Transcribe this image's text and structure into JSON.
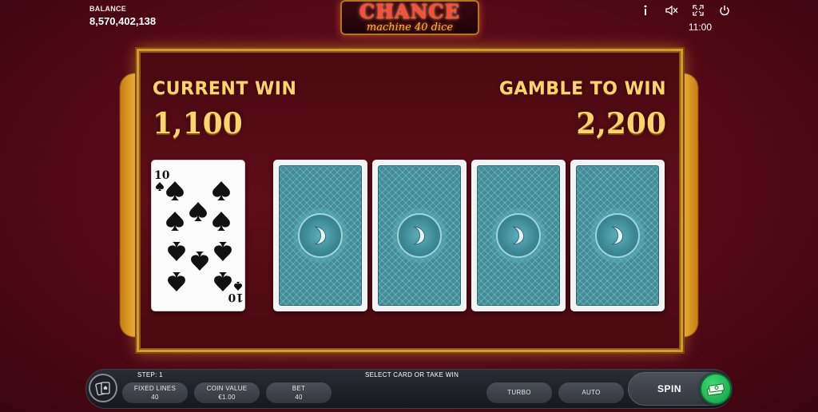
{
  "header": {
    "balance_label": "BALANCE",
    "balance_value": "8,570,402,138",
    "logo_main": "CHANCE",
    "logo_sub": "machine 40 dice",
    "clock": "11:00",
    "icons": [
      "info-icon",
      "sound-muted-icon",
      "fullscreen-icon",
      "power-icon"
    ]
  },
  "gamble": {
    "current_win_label": "CURRENT WIN",
    "current_win_value": "1,100",
    "gamble_to_win_label": "GAMBLE TO WIN",
    "gamble_to_win_value": "2,200",
    "dealer_card": {
      "rank": "10",
      "suit": "spades"
    },
    "hidden_cards": 4
  },
  "bottom_bar": {
    "step_label": "STEP: 1",
    "instruction": "SELECT CARD OR TAKE WIN",
    "fixed_lines_label": "FIXED LINES",
    "fixed_lines_value": "40",
    "coin_value_label": "COIN VALUE",
    "coin_value_value": "€1.00",
    "bet_label": "BET",
    "bet_value": "40",
    "turbo_label": "TURBO",
    "auto_label": "AUTO",
    "spin_label": "SPIN"
  },
  "colors": {
    "background": "#5a0a18",
    "gold_text": "#ffd36b",
    "card_back": "#3f8e9a",
    "collect_button": "#1fb552"
  }
}
